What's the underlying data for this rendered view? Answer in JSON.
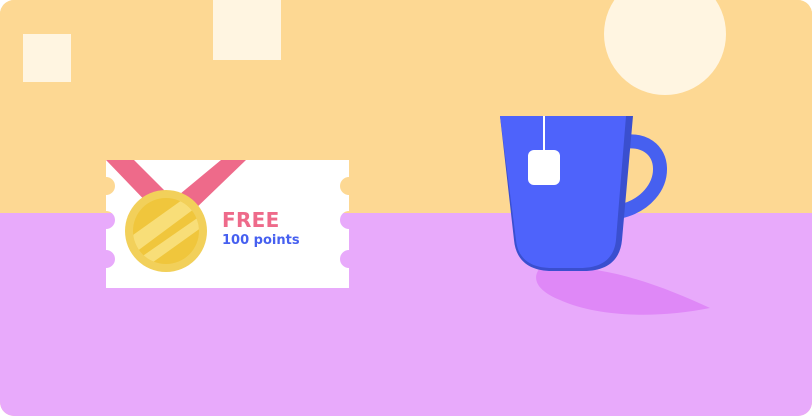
{
  "ticket": {
    "title": "FREE",
    "subtitle": "100 points",
    "title_color": "#ee6a8a",
    "subtitle_color": "#4660f0"
  },
  "icons": {
    "medal": "medal-icon",
    "mug": "tea-mug-icon",
    "tea_bag": "tea-bag-icon"
  },
  "colors": {
    "wall": "#fdd893",
    "table": "#e8aafb",
    "cream": "#fff5e1",
    "mug": "#4660f0",
    "ribbon": "#ee6a8a",
    "medal": "#f2d05a"
  }
}
